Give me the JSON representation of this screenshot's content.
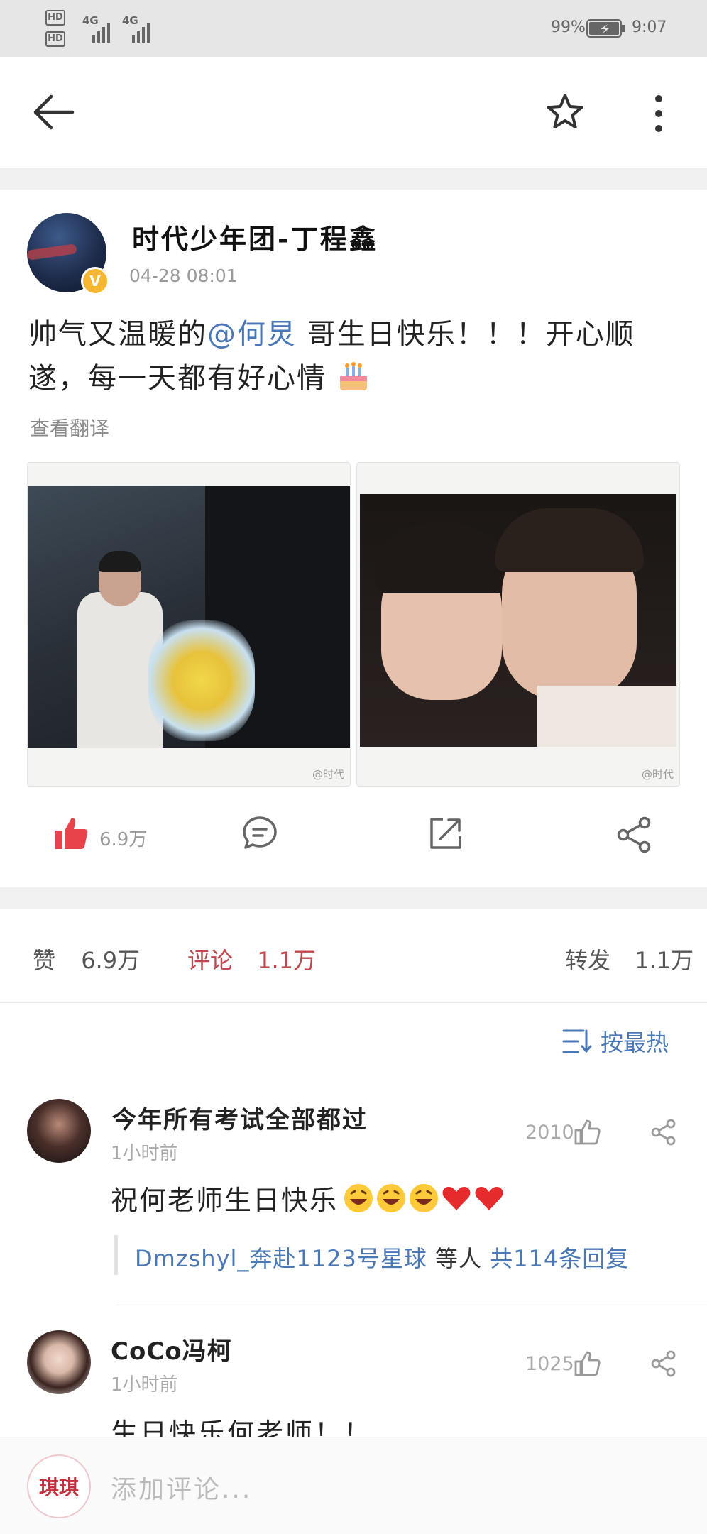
{
  "status_bar": {
    "left_labels": [
      "HD",
      "HD",
      "4G",
      "4G"
    ],
    "battery": "99%",
    "time": "9:07"
  },
  "post": {
    "author": "时代少年团-丁程鑫",
    "timestamp": "04-28 08:01",
    "text_line1_a": "帅气又温暖的",
    "mention": "@何炅",
    "text_line1_b": " 哥生日快乐！！！开心顺",
    "text_line2": "遂，每一天都有好心情",
    "translate": "查看翻译",
    "image_watermark_1": "@时代",
    "image_watermark_2": "@时代",
    "like_count": "6.9万"
  },
  "stats": {
    "likes_label": "赞",
    "likes_count": "6.9万",
    "comments_label": "评论",
    "comments_count": "1.1万",
    "reposts_label": "转发",
    "reposts_count": "1.1万"
  },
  "sort": {
    "label": "按最热"
  },
  "comments": [
    {
      "user": "今年所有考试全部都过",
      "time": "1小时前",
      "likes": "2010",
      "text": "祝何老师生日快乐",
      "reply_user": "Dmzshyl_奔赴1123号星球",
      "reply_mid": " 等人 ",
      "reply_count": "共114条回复"
    },
    {
      "user": "CoCo冯柯",
      "time": "1小时前",
      "likes": "1025",
      "text": "生日快乐何老师！！"
    }
  ],
  "composer": {
    "placeholder": "添加评论...",
    "avatar_text": "琪琪"
  },
  "colors": {
    "accent_red": "#e8424b",
    "link_blue": "#4a78b6",
    "verified_gold": "#f5b731"
  }
}
